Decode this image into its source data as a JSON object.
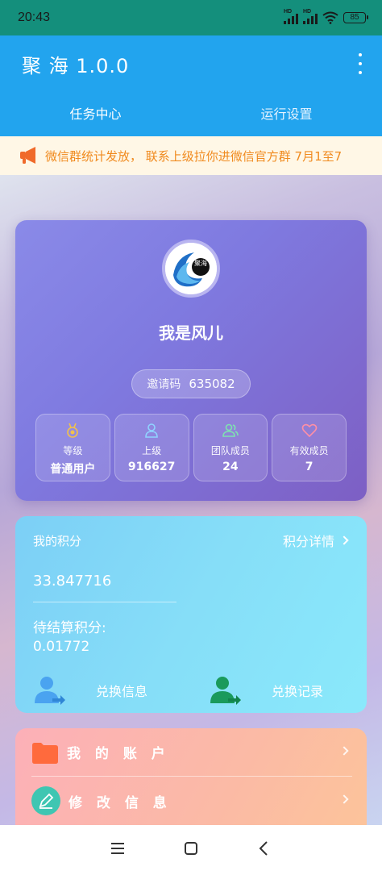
{
  "status_bar": {
    "time": "20:43",
    "battery": "85",
    "network_badge": "HD",
    "icons": [
      "signal-icon",
      "signal-icon",
      "wifi-icon",
      "battery-icon"
    ]
  },
  "app_bar": {
    "title": "聚 海 1.0.0",
    "menu_icon": "more-vertical-icon"
  },
  "tabs": [
    {
      "label": "任务中心",
      "active": true
    },
    {
      "label": "运行设置",
      "active": false
    }
  ],
  "notice": {
    "icon": "megaphone-icon",
    "text": "微信群统计发放， 联系上级拉你进微信官方群 7月1至7"
  },
  "profile": {
    "avatar_text": "聚海",
    "nickname": "我是风儿",
    "invite_label": "邀请码",
    "invite_code": "635082",
    "stats": [
      {
        "icon": "medal-icon",
        "label": "等级",
        "value": "普通用户"
      },
      {
        "icon": "user-icon",
        "label": "上级",
        "value": "916627"
      },
      {
        "icon": "team-icon",
        "label": "团队成员",
        "value": "24"
      },
      {
        "icon": "heart-icon",
        "label": "有效成员",
        "value": "7"
      }
    ]
  },
  "points": {
    "title": "我的积分",
    "detail_label": "积分详情",
    "value": "33.847716",
    "pending_label": "待结算积分:",
    "pending_value": "0.01772",
    "exchange_info_label": "兑换信息",
    "exchange_record_label": "兑换记录"
  },
  "menu": [
    {
      "icon": "folder-icon",
      "label": "我 的 账 户"
    },
    {
      "icon": "edit-icon",
      "label": "修 改 信 息"
    }
  ],
  "colors": {
    "status_bar": "#148f7c",
    "app_bar": "#22a4ee",
    "notice_text": "#f08a1e",
    "notice_icon": "#f06a2a"
  }
}
